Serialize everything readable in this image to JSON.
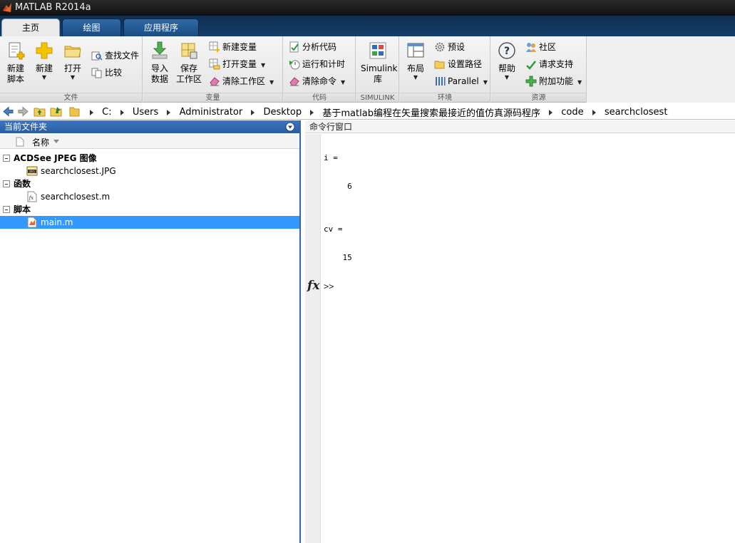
{
  "window": {
    "title": "MATLAB R2014a"
  },
  "tabs": [
    {
      "label": "主页",
      "active": true
    },
    {
      "label": "绘图",
      "active": false
    },
    {
      "label": "应用程序",
      "active": false
    }
  ],
  "ribbon": {
    "file_group": {
      "label": "文件",
      "new_script_line1": "新建",
      "new_script_line2": "脚本",
      "new": "新建",
      "open": "打开",
      "find_files": "查找文件",
      "compare": "比较"
    },
    "variable_group": {
      "label": "变量",
      "import_line1": "导入",
      "import_line2": "数据",
      "save_line1": "保存",
      "save_line2": "工作区",
      "new_variable": "新建变量",
      "open_variable": "打开变量",
      "clear_workspace": "清除工作区"
    },
    "code_group": {
      "label": "代码",
      "analyze_code": "分析代码",
      "run_and_time": "运行和计时",
      "clear_commands": "清除命令"
    },
    "simulink_group": {
      "label": "SIMULINK",
      "simulink_line1": "Simulink",
      "simulink_line2": "库"
    },
    "environment_group": {
      "label": "环境",
      "layout": "布局",
      "preferences": "预设",
      "set_path": "设置路径",
      "parallel": "Parallel"
    },
    "resources_group": {
      "label": "资源",
      "help": "帮助",
      "community": "社区",
      "request_support": "请求支持",
      "add_ons": "附加功能"
    }
  },
  "address": {
    "crumbs": [
      "C:",
      "Users",
      "Administrator",
      "Desktop",
      "基于matlab编程在矢量搜索最接近的值仿真源码程序",
      "code",
      "searchclosest"
    ]
  },
  "current_folder": {
    "title": "当前文件夹",
    "column_name": "名称",
    "groups": [
      {
        "label": "ACDSee JPEG 图像",
        "items": [
          "searchclosest.JPG"
        ]
      },
      {
        "label": "函数",
        "items": [
          "searchclosest.m"
        ]
      },
      {
        "label": "脚本",
        "items": [
          "main.m"
        ]
      }
    ],
    "selected_item": "main.m"
  },
  "command_window": {
    "title": "命令行窗口",
    "lines": [
      {
        "text": "i ="
      },
      {
        "text": "     6"
      },
      {
        "text": "cv ="
      },
      {
        "text": "    15"
      }
    ],
    "fx_label": "fx",
    "prompt": ">>"
  },
  "colors": {
    "tab_bar": "#153e6a",
    "panel_title": "#2a5da3",
    "selection": "#3399ff"
  }
}
